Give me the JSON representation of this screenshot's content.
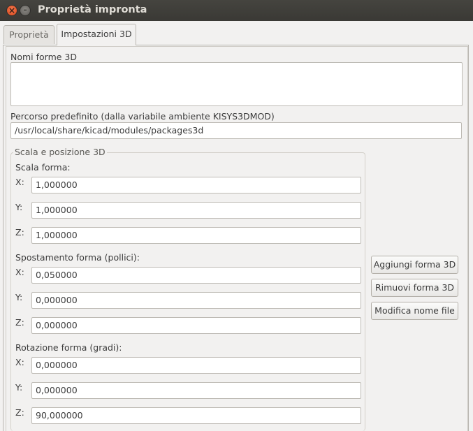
{
  "window": {
    "title": "Proprietà impronta"
  },
  "tabs": [
    {
      "label": "Proprietà"
    },
    {
      "label": "Impostazioni 3D"
    }
  ],
  "shapes": {
    "label": "Nomi forme 3D"
  },
  "path": {
    "label": "Percorso predefinito (dalla variabile ambiente KISYS3DMOD)",
    "value": "/usr/local/share/kicad/modules/packages3d"
  },
  "group": {
    "title": "Scala e posizione 3D",
    "scale": {
      "label": "Scala forma:",
      "x": "1,000000",
      "y": "1,000000",
      "z": "1,000000"
    },
    "offset": {
      "label": "Spostamento forma (pollici):",
      "x": "0,050000",
      "y": "0,000000",
      "z": "0,000000"
    },
    "rotation": {
      "label": "Rotazione forma (gradi):",
      "x": "0,000000",
      "y": "0,000000",
      "z": "90,000000"
    }
  },
  "axis": {
    "x": "X:",
    "y": "Y:",
    "z": "Z:"
  },
  "buttons": {
    "add": "Aggiungi forma 3D",
    "remove": "Rimuovi forma 3D",
    "rename": "Modifica nome file"
  }
}
